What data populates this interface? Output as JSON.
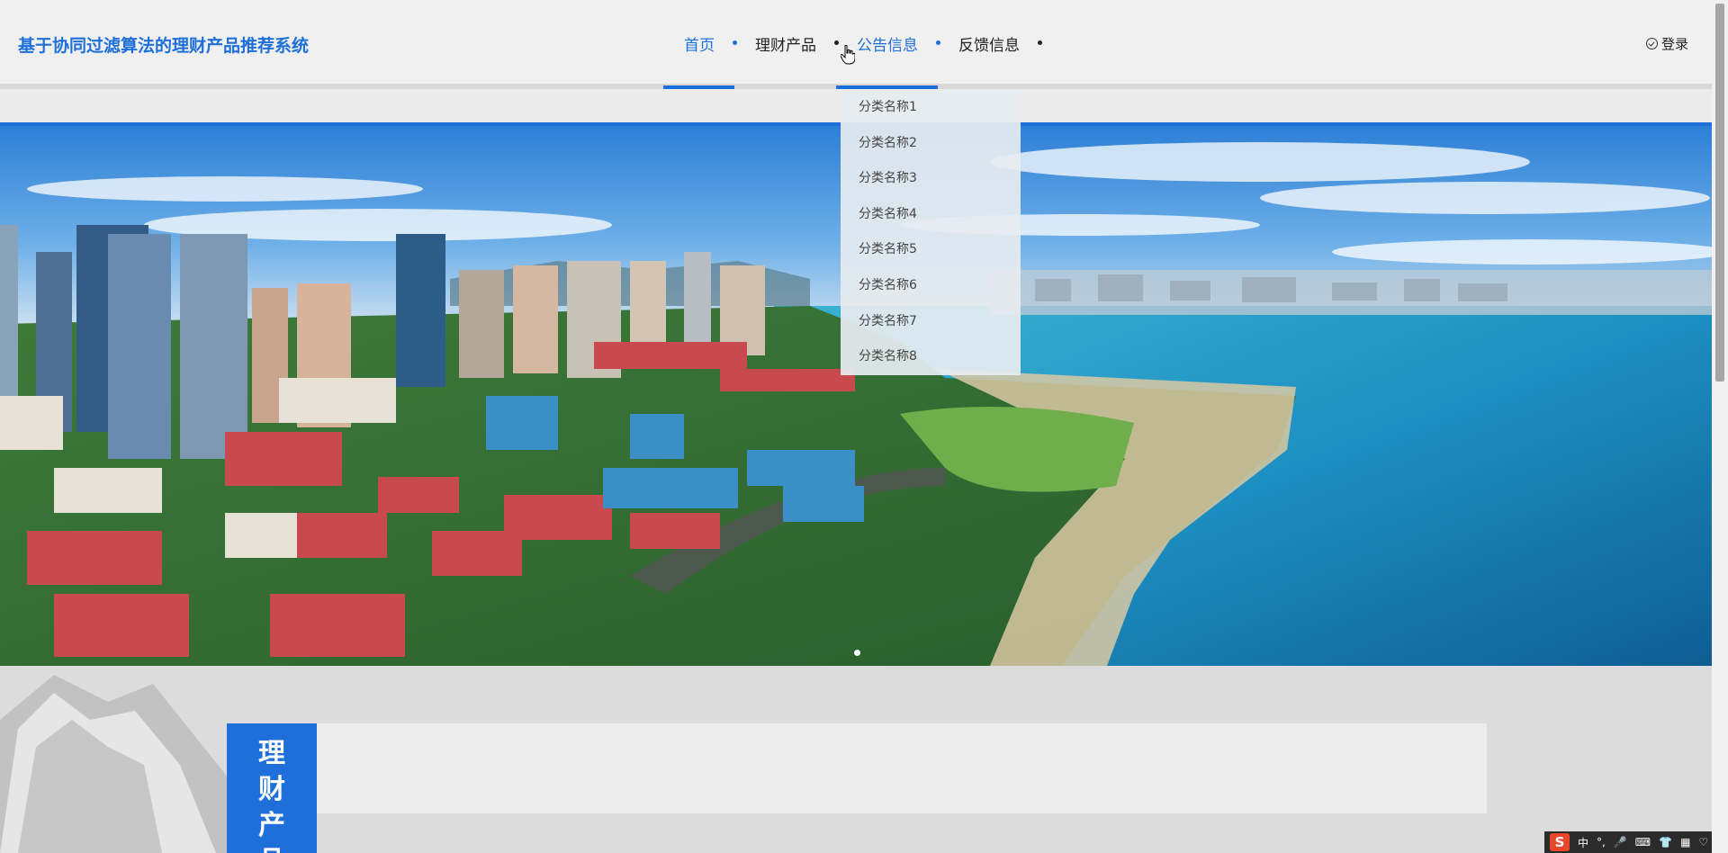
{
  "header": {
    "site_title": "基于协同过滤算法的理财产品推荐系统",
    "login_label": "登录"
  },
  "nav": {
    "items": [
      {
        "label": "首页",
        "state": "active"
      },
      {
        "label": "理财产品",
        "state": "normal"
      },
      {
        "label": "公告信息",
        "state": "hover"
      },
      {
        "label": "反馈信息",
        "state": "normal"
      }
    ]
  },
  "dropdown": {
    "items": [
      "分类名称1",
      "分类名称2",
      "分类名称3",
      "分类名称4",
      "分类名称5",
      "分类名称6",
      "分类名称7",
      "分类名称8"
    ]
  },
  "banner": {
    "image": "coastal-city-aerial-photo",
    "current_slide": 1
  },
  "section": {
    "tag_chars": [
      "理",
      "财",
      "产",
      "品"
    ]
  },
  "taskbar": {
    "ime_logo": "S",
    "glyphs": [
      "中",
      "°,",
      "🎤",
      "⌨",
      "👕",
      "▦",
      "♡"
    ]
  },
  "colors": {
    "accent": "#1e6fd9",
    "header_bg": "#f0f0f0"
  }
}
